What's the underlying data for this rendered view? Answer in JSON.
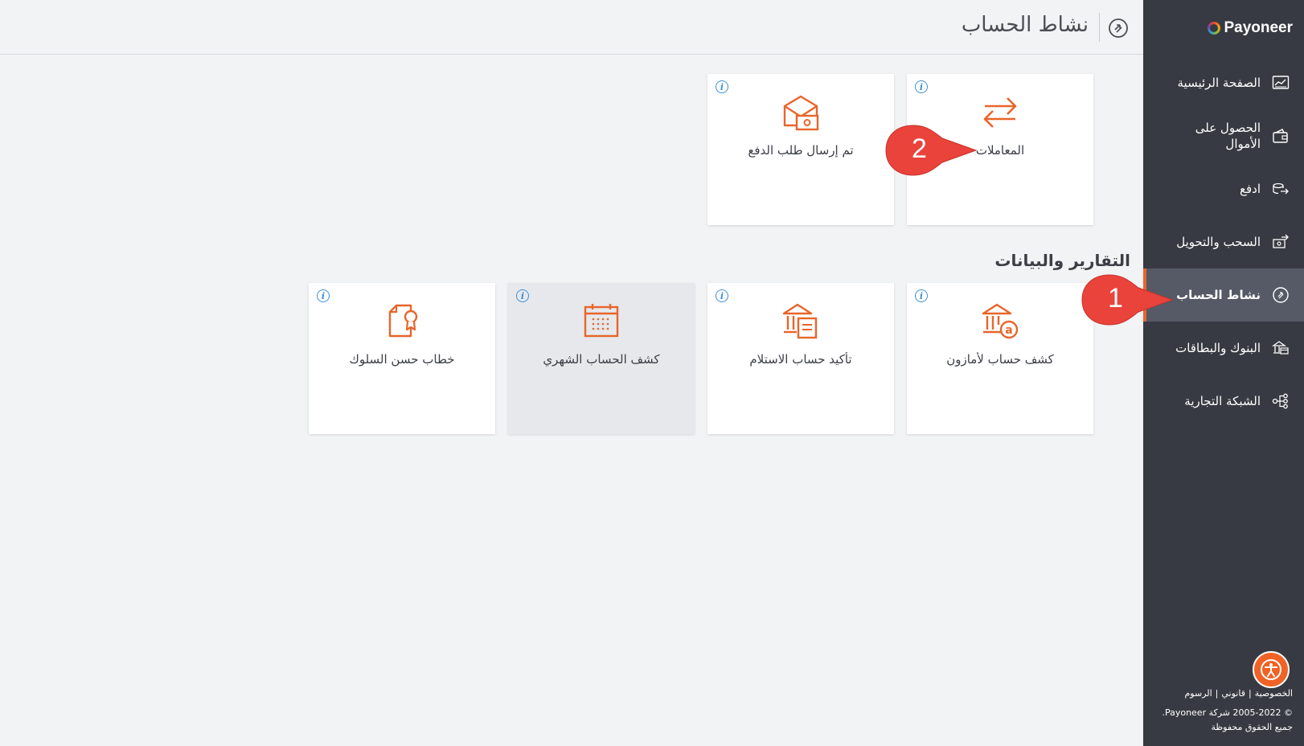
{
  "header": {
    "title": "نشاط الحساب"
  },
  "brand": {
    "name": "Payoneer",
    "accent": "#e8652a",
    "sidebar_bg": "#373a42"
  },
  "sidebar": {
    "items": [
      {
        "label": "الصفحة الرئيسية",
        "icon": "chart-icon",
        "active": false
      },
      {
        "label": "الحصول على الأموال",
        "icon": "wallet-icon",
        "active": false
      },
      {
        "label": "ادفع",
        "icon": "pay-icon",
        "active": false
      },
      {
        "label": "السحب والتحويل",
        "icon": "withdraw-icon",
        "active": false
      },
      {
        "label": "نشاط الحساب",
        "icon": "activity-icon",
        "active": true
      },
      {
        "label": "البنوك والبطاقات",
        "icon": "bank-icon",
        "active": false
      },
      {
        "label": "الشبكة التجارية",
        "icon": "network-icon",
        "active": false
      }
    ],
    "footer": {
      "links": [
        "الخصوصية",
        "قانوني",
        "الرسوم"
      ],
      "copyright": "© 2005-2022 شركة Payoneer.",
      "rights": "جميع الحقوق محفوظة"
    }
  },
  "activity_tiles": [
    {
      "label": "المعاملات",
      "icon": "transfer-arrows-icon"
    },
    {
      "label": "تم إرسال طلب الدفع",
      "icon": "payment-request-icon"
    }
  ],
  "reports": {
    "title": "التقارير والبيانات",
    "tiles": [
      {
        "label": "كشف حساب لأمازون",
        "icon": "amazon-bank-icon"
      },
      {
        "label": "تأكيد حساب الاستلام",
        "icon": "receiving-account-icon"
      },
      {
        "label": "كشف الحساب الشهري",
        "icon": "calendar-icon",
        "hovered": true
      },
      {
        "label": "خطاب حسن السلوك",
        "icon": "certificate-icon"
      }
    ]
  },
  "callouts": [
    "1",
    "2"
  ]
}
